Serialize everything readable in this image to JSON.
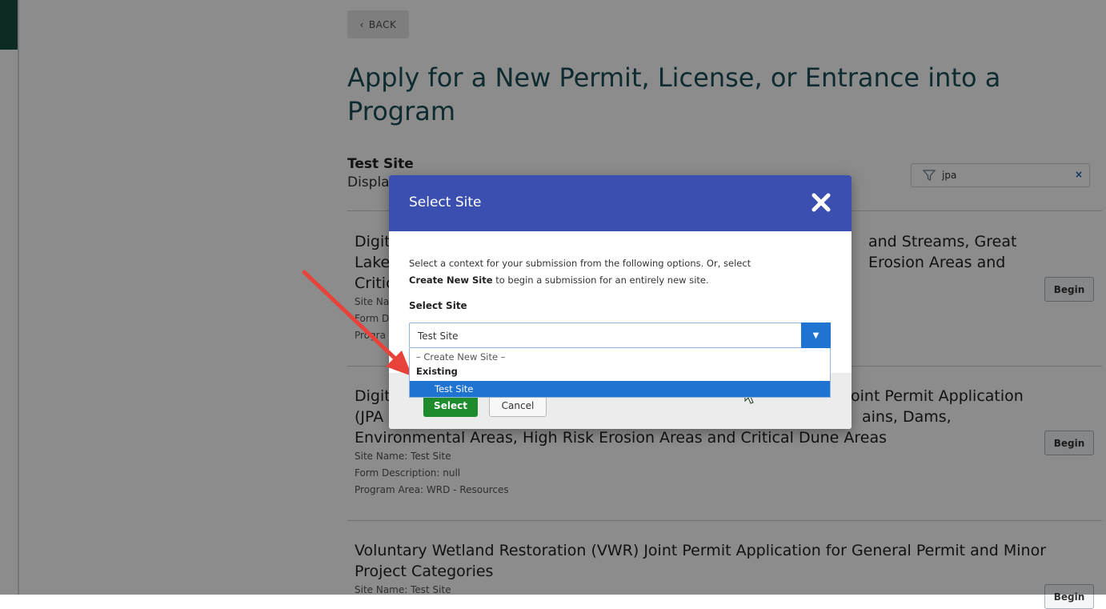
{
  "back_button": {
    "icon": "chevron-left-icon",
    "label": "BACK"
  },
  "page_title": "Apply for a New Permit, License, or Entrance into a Program",
  "site_section": {
    "heading": "Test Site",
    "subheading": "Displa"
  },
  "filter": {
    "icon": "filter-icon",
    "value": "jpa",
    "clear": "×"
  },
  "items": [
    {
      "title_line1": "Digit",
      "title_line1_right": "and Streams, Great",
      "title_line2": "Lake",
      "title_line2_right": "Erosion Areas and",
      "title_line3": "Critic",
      "meta1": "Site Na",
      "meta2": "Form D",
      "meta3": "Progra",
      "begin": "Begin"
    },
    {
      "title_line1": "Digit",
      "title_line1_right": "oint Permit Application",
      "title_line2": "(JPA",
      "title_line2_right": "ains, Dams,",
      "title_line3": "Environmental Areas, High Risk Erosion Areas and Critical Dune Areas",
      "site_name": "Site Name: Test Site",
      "form_description": "Form Description: null",
      "program_area": "Program Area: WRD - Resources",
      "begin": "Begin"
    },
    {
      "title": "Voluntary Wetland Restoration (VWR) Joint Permit Application for General Permit and Minor Project Categories",
      "site_name": "Site Name: Test Site",
      "begin": "Begin"
    }
  ],
  "modal": {
    "title": "Select Site",
    "close_icon": "close-icon",
    "description_part1": "Select a context for your submission from the following options. Or, select",
    "description_bold": "Create New Site",
    "description_part2": " to begin a submission for an entirely new site.",
    "field_label": "Select Site",
    "selected_value": "Test Site",
    "options": {
      "create": "– Create New Site –",
      "group": "Existing",
      "highlighted": "Test Site"
    },
    "select_button": "Select",
    "cancel_button": "Cancel"
  },
  "colors": {
    "modal_header": "#3b4fb0",
    "select_button": "#1e8b2c",
    "dropdown_highlight": "#1f73d1",
    "title_text": "#1b4f56",
    "annotation_arrow": "#e8433a"
  }
}
